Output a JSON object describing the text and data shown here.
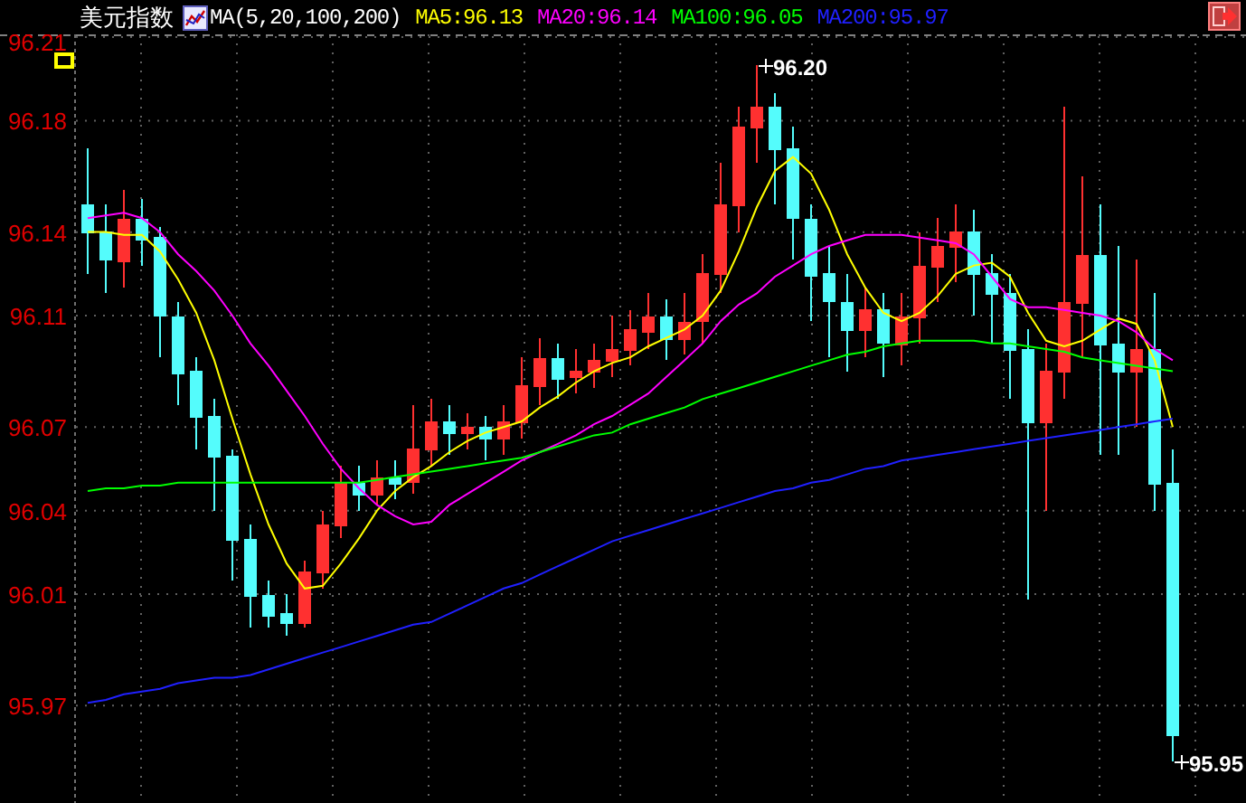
{
  "header": {
    "title": "美元指数",
    "indicator": "MA(5,20,100,200)",
    "legend": [
      {
        "text": "MA5:96.13",
        "color": "#ffff00"
      },
      {
        "text": "MA20:96.14",
        "color": "#ff00ff"
      },
      {
        "text": "MA100:96.05",
        "color": "#00ff00"
      },
      {
        "text": "MA200:95.97",
        "color": "#2020ff"
      }
    ]
  },
  "chart": {
    "chart_data": {
      "type": "candlestick",
      "grid": true,
      "categories": [
        null,
        null,
        null,
        null,
        null,
        null,
        null,
        null,
        null,
        null,
        null,
        null,
        null,
        null,
        null,
        null,
        null,
        null,
        null,
        null,
        null,
        null,
        null,
        null,
        null,
        null,
        null,
        null,
        null,
        null,
        null,
        null,
        null,
        null,
        null,
        null,
        null,
        null,
        null,
        null,
        null,
        null,
        null,
        null,
        null,
        null,
        null,
        null,
        null,
        null,
        null,
        null,
        null,
        null,
        null,
        null,
        null,
        null,
        null,
        null,
        null
      ],
      "ylim": [
        95.935,
        96.211
      ],
      "yticks": [
        95.97,
        96.01,
        96.04,
        96.07,
        96.11,
        96.14,
        96.18,
        96.21
      ],
      "series": [
        {
          "type": "line",
          "color": "#ffff00",
          "values": [
            96.14,
            96.14,
            96.139,
            96.139,
            96.133,
            96.123,
            96.111,
            96.094,
            96.073,
            96.053,
            96.035,
            96.021,
            96.012,
            96.013,
            96.021,
            96.03,
            96.04,
            96.047,
            96.052,
            96.056,
            96.061,
            96.065,
            96.068,
            96.07,
            96.072,
            96.077,
            96.081,
            96.086,
            96.09,
            96.093,
            96.095,
            96.099,
            96.102,
            96.105,
            96.11,
            96.119,
            96.133,
            96.149,
            96.162,
            96.167,
            96.161,
            96.148,
            96.132,
            96.12,
            96.111,
            96.108,
            96.111,
            96.117,
            96.125,
            96.128,
            96.129,
            96.124,
            96.111,
            96.101,
            96.099,
            96.101,
            96.105,
            96.109,
            96.107,
            96.094,
            96.07
          ]
        },
        {
          "type": "line",
          "color": "#ff00ff",
          "values": [
            96.145,
            96.146,
            96.147,
            96.145,
            96.14,
            96.132,
            96.126,
            96.119,
            96.11,
            96.1,
            96.092,
            96.083,
            96.074,
            96.064,
            96.055,
            96.048,
            96.042,
            96.038,
            96.035,
            96.036,
            96.042,
            96.046,
            96.05,
            96.054,
            96.058,
            96.061,
            96.064,
            96.067,
            96.071,
            96.074,
            96.078,
            96.082,
            96.088,
            96.094,
            96.1,
            96.108,
            96.114,
            96.118,
            96.124,
            96.128,
            96.132,
            96.135,
            96.137,
            96.139,
            96.139,
            96.139,
            96.138,
            96.137,
            96.136,
            96.132,
            96.124,
            96.116,
            96.113,
            96.113,
            96.112,
            96.111,
            96.11,
            96.108,
            96.104,
            96.098,
            96.094
          ]
        },
        {
          "type": "line",
          "color": "#00ff00",
          "values": [
            96.047,
            96.048,
            96.048,
            96.049,
            96.049,
            96.05,
            96.05,
            96.05,
            96.05,
            96.05,
            96.05,
            96.05,
            96.05,
            96.05,
            96.05,
            96.05,
            96.051,
            96.052,
            96.053,
            96.054,
            96.055,
            96.056,
            96.057,
            96.058,
            96.059,
            96.061,
            96.063,
            96.065,
            96.067,
            96.068,
            96.071,
            96.073,
            96.075,
            96.077,
            96.08,
            96.082,
            96.084,
            96.086,
            96.088,
            96.09,
            96.092,
            96.094,
            96.096,
            96.097,
            96.099,
            96.1,
            96.101,
            96.101,
            96.101,
            96.101,
            96.1,
            96.1,
            96.099,
            96.098,
            96.097,
            96.095,
            96.094,
            96.093,
            96.092,
            96.091,
            96.09
          ]
        },
        {
          "type": "line",
          "color": "#2020ff",
          "values": [
            95.971,
            95.972,
            95.974,
            95.975,
            95.976,
            95.978,
            95.979,
            95.98,
            95.98,
            95.981,
            95.983,
            95.985,
            95.987,
            95.989,
            95.991,
            95.993,
            95.995,
            95.997,
            95.999,
            96.0,
            96.003,
            96.006,
            96.009,
            96.012,
            96.014,
            96.017,
            96.02,
            96.023,
            96.026,
            96.029,
            96.031,
            96.033,
            96.035,
            96.037,
            96.039,
            96.041,
            96.043,
            96.045,
            96.047,
            96.048,
            96.05,
            96.051,
            96.053,
            96.055,
            96.056,
            96.058,
            96.059,
            96.06,
            96.061,
            96.062,
            96.063,
            96.064,
            96.065,
            96.066,
            96.067,
            96.068,
            96.069,
            96.07,
            96.071,
            96.072,
            96.073
          ]
        }
      ],
      "ohlc": [
        [
          96.15,
          96.17,
          96.125,
          96.14
        ],
        [
          96.14,
          96.15,
          96.118,
          96.13
        ],
        [
          96.13,
          96.155,
          96.12,
          96.145
        ],
        [
          96.145,
          96.152,
          96.128,
          96.138
        ],
        [
          96.138,
          96.142,
          96.095,
          96.11
        ],
        [
          96.11,
          96.115,
          96.078,
          96.09
        ],
        [
          96.09,
          96.095,
          96.062,
          96.074
        ],
        [
          96.074,
          96.08,
          96.04,
          96.06
        ],
        [
          96.06,
          96.062,
          96.015,
          96.03
        ],
        [
          96.03,
          96.035,
          95.998,
          96.01
        ],
        [
          96.01,
          96.015,
          95.998,
          96.003
        ],
        [
          96.003,
          96.01,
          95.995,
          96.0
        ],
        [
          96.0,
          96.022,
          95.998,
          96.018
        ],
        [
          96.018,
          96.04,
          96.012,
          96.035
        ],
        [
          96.035,
          96.056,
          96.03,
          96.05
        ],
        [
          96.05,
          96.056,
          96.04,
          96.046
        ],
        [
          96.046,
          96.058,
          96.042,
          96.052
        ],
        [
          96.052,
          96.058,
          96.044,
          96.05
        ],
        [
          96.05,
          96.078,
          96.046,
          96.062
        ],
        [
          96.062,
          96.08,
          96.056,
          96.072
        ],
        [
          96.072,
          96.078,
          96.06,
          96.068
        ],
        [
          96.068,
          96.075,
          96.062,
          96.07
        ],
        [
          96.07,
          96.074,
          96.058,
          96.066
        ],
        [
          96.066,
          96.078,
          96.06,
          96.072
        ],
        [
          96.072,
          96.095,
          96.066,
          96.085
        ],
        [
          96.085,
          96.102,
          96.078,
          96.095
        ],
        [
          96.095,
          96.1,
          96.08,
          96.088
        ],
        [
          96.088,
          96.098,
          96.082,
          96.09
        ],
        [
          96.09,
          96.1,
          96.084,
          96.094
        ],
        [
          96.094,
          96.11,
          96.088,
          96.098
        ],
        [
          96.098,
          96.112,
          96.092,
          96.105
        ],
        [
          96.105,
          96.118,
          96.098,
          96.11
        ],
        [
          96.11,
          96.116,
          96.094,
          96.102
        ],
        [
          96.102,
          96.118,
          96.096,
          96.108
        ],
        [
          96.108,
          96.132,
          96.1,
          96.125
        ],
        [
          96.125,
          96.165,
          96.118,
          96.15
        ],
        [
          96.15,
          96.185,
          96.14,
          96.178
        ],
        [
          96.178,
          96.2,
          96.165,
          96.185
        ],
        [
          96.185,
          96.19,
          96.15,
          96.17
        ],
        [
          96.17,
          96.178,
          96.13,
          96.145
        ],
        [
          96.145,
          96.15,
          96.108,
          96.125
        ],
        [
          96.125,
          96.135,
          96.095,
          96.115
        ],
        [
          96.115,
          96.125,
          96.09,
          96.105
        ],
        [
          96.105,
          96.12,
          96.095,
          96.112
        ],
        [
          96.112,
          96.118,
          96.088,
          96.1
        ],
        [
          96.1,
          96.118,
          96.092,
          96.11
        ],
        [
          96.11,
          96.14,
          96.1,
          96.128
        ],
        [
          96.128,
          96.145,
          96.115,
          96.135
        ],
        [
          96.135,
          96.15,
          96.122,
          96.14
        ],
        [
          96.14,
          96.148,
          96.11,
          96.125
        ],
        [
          96.125,
          96.132,
          96.1,
          96.118
        ],
        [
          96.118,
          96.125,
          96.08,
          96.098
        ],
        [
          96.098,
          96.105,
          96.008,
          96.072
        ],
        [
          96.072,
          96.1,
          96.04,
          96.09
        ],
        [
          96.09,
          96.185,
          96.08,
          96.115
        ],
        [
          96.115,
          96.16,
          96.095,
          96.132
        ],
        [
          96.132,
          96.15,
          96.06,
          96.1
        ],
        [
          96.1,
          96.135,
          96.06,
          96.09
        ],
        [
          96.09,
          96.13,
          96.07,
          96.098
        ],
        [
          96.098,
          96.118,
          96.04,
          96.05
        ],
        [
          96.05,
          96.062,
          95.95,
          95.96
        ]
      ],
      "annotations": [
        "96.20",
        "95.95"
      ]
    }
  }
}
